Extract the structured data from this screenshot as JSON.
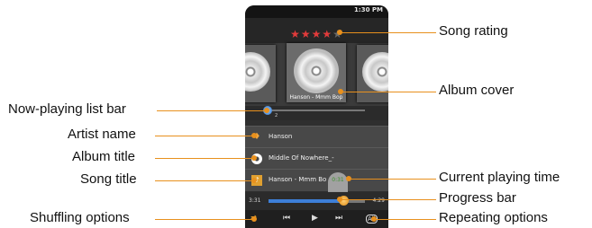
{
  "status_bar": {
    "clock": "1:30 PM"
  },
  "rating": {
    "filled": 4,
    "total": 5
  },
  "cover": {
    "caption": "Hanson - Mmm Bop"
  },
  "list_bar": {
    "index": "2"
  },
  "artist": "Hanson",
  "album": "Middle Of Nowhere_-",
  "song": "Hanson - Mmm Bo",
  "playing_time": "0:31",
  "progress": {
    "elapsed": "3:31",
    "total": "4:29",
    "fraction": 0.78
  },
  "controls": {
    "shuffle": "⇄",
    "prev": "⏮",
    "play": "▶",
    "next": "⏭",
    "repeat": "All"
  },
  "labels": {
    "song_rating": "Song rating",
    "album_cover": "Album cover",
    "now_playing": "Now-playing list bar",
    "artist_name": "Artist name",
    "album_title": "Album title",
    "song_title": "Song title",
    "current_time": "Current playing time",
    "progress_bar": "Progress bar",
    "shuffle": "Shuffling options",
    "repeat": "Repeating options"
  },
  "colors": {
    "accent": "#e8901d",
    "star": "#e23b3b",
    "progress": "#3d7fd8"
  }
}
